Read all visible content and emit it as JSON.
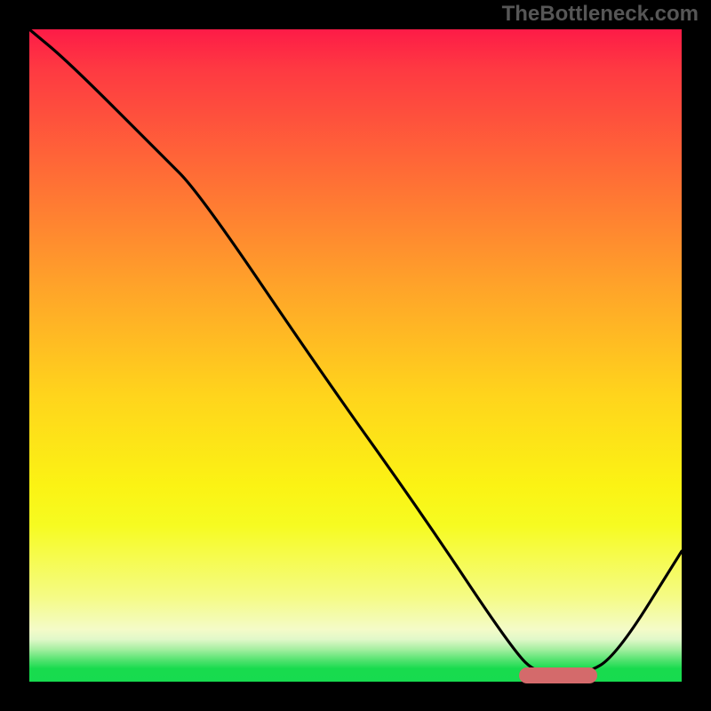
{
  "attribution": "TheBottleneck.com",
  "colors": {
    "frame": "#000000",
    "curve": "#000000",
    "marker": "#d46a6b",
    "gradient_top": "#fd1b47",
    "gradient_bottom": "#17db4f"
  },
  "chart_data": {
    "type": "line",
    "title": "",
    "xlabel": "",
    "ylabel": "",
    "xlim": [
      0,
      100
    ],
    "ylim": [
      0,
      100
    ],
    "grid": false,
    "series": [
      {
        "name": "bottleneck-curve",
        "x": [
          0,
          6,
          20,
          26,
          45,
          60,
          74,
          78,
          85,
          90,
          100
        ],
        "values": [
          100,
          95,
          81,
          75,
          47,
          26,
          5,
          1,
          1,
          4,
          20
        ]
      }
    ],
    "annotations": [
      {
        "name": "optimal-band",
        "shape": "rounded-bar",
        "x_start": 75,
        "x_end": 87,
        "y": 1,
        "color": "#d46a6b"
      }
    ],
    "background": "heatmap-gradient (green at bottom → yellow → orange → red at top)"
  }
}
